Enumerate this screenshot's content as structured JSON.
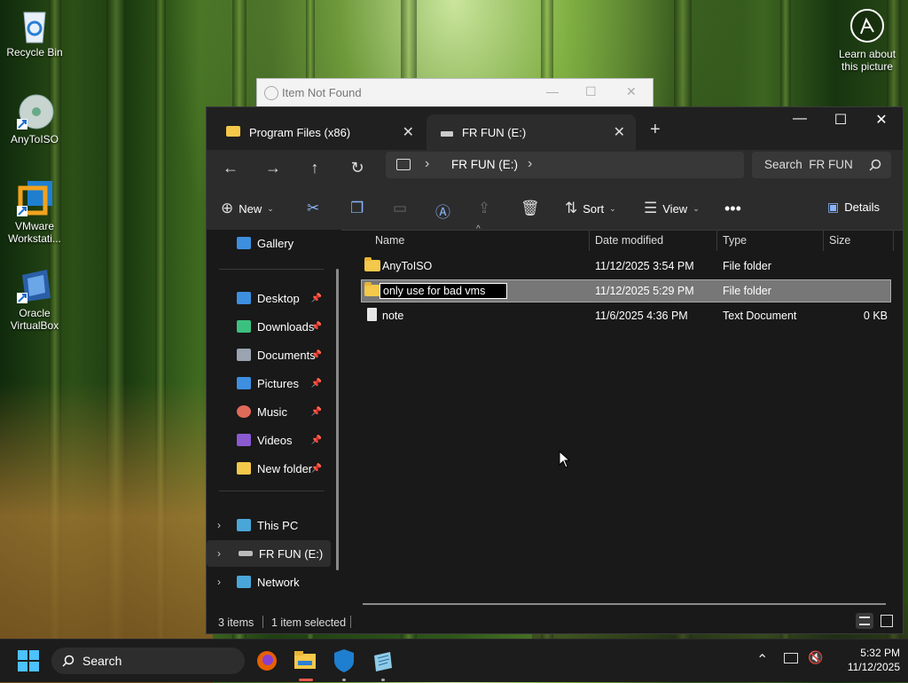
{
  "desktop": {
    "icons": [
      {
        "label": "Recycle Bin"
      },
      {
        "label": "AnyToISO"
      },
      {
        "label": "VMware Workstati..."
      },
      {
        "label": "Oracle VirtualBox"
      }
    ],
    "learn_label": "Learn about this picture"
  },
  "ghost_window": {
    "title": "Item Not Found"
  },
  "explorer": {
    "tabs": [
      {
        "label": "Program Files (x86)"
      },
      {
        "label": "FR FUN (E:)"
      }
    ],
    "breadcrumb": {
      "current": "FR FUN (E:)"
    },
    "search_placeholder": "Search  FR FUN",
    "commands": {
      "new": "New",
      "sort": "Sort",
      "view": "View",
      "details": "Details"
    },
    "nav_pane": {
      "gallery": "Gallery",
      "quick": [
        {
          "label": "Desktop",
          "color": "#3d8fe0"
        },
        {
          "label": "Downloads",
          "color": "#3cc080"
        },
        {
          "label": "Documents",
          "color": "#9aa4b0"
        },
        {
          "label": "Pictures",
          "color": "#3d8fe0"
        },
        {
          "label": "Music",
          "color": "#e06a5a"
        },
        {
          "label": "Videos",
          "color": "#8a5ad0"
        },
        {
          "label": "New folder",
          "color": "#f4c84a"
        }
      ],
      "this_pc": "This PC",
      "drive": "FR FUN (E:)",
      "network": "Network"
    },
    "columns": {
      "name": "Name",
      "date": "Date modified",
      "type": "Type",
      "size": "Size"
    },
    "files": [
      {
        "name": "AnyToISO",
        "date": "11/12/2025 3:54 PM",
        "type": "File folder",
        "size": ""
      },
      {
        "name": "only use for bad vms",
        "date": "11/12/2025 5:29 PM",
        "type": "File folder",
        "size": ""
      },
      {
        "name": "note",
        "date": "11/6/2025 4:36 PM",
        "type": "Text Document",
        "size": "0 KB"
      }
    ],
    "status": {
      "items": "3 items",
      "selected": "1 item selected"
    }
  },
  "taskbar": {
    "search_label": "Search",
    "time": "5:32 PM",
    "date": "11/12/2025"
  }
}
